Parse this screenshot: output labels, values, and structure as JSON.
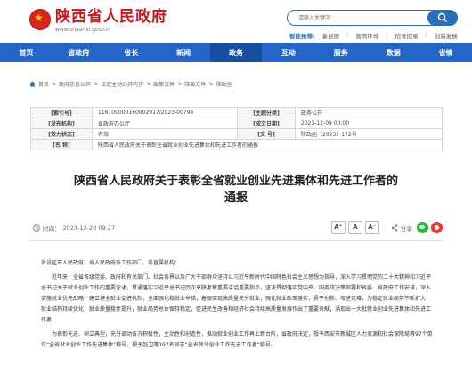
{
  "header": {
    "site_name": "陕西省人民政府",
    "site_url": "www.shaanxi.gov.cn",
    "search_placeholder": "请输入关键字",
    "smart_label": "智能推荐:",
    "smart_links": [
      "秦创原",
      "营商环境",
      "招考招录",
      "创新发展"
    ]
  },
  "nav": {
    "items": [
      "首页",
      "省政府",
      "省长",
      "新闻",
      "政务",
      "互动",
      "服务",
      "数据",
      "省情"
    ],
    "active_index": 4
  },
  "breadcrumb": [
    "首页",
    "政府信息公开",
    "法定主动公开内容",
    "政策文件",
    "陕政文件",
    "陕政函"
  ],
  "info": {
    "index_label": "[索引号]",
    "index_value": "11610000016000291​7/2023-00794",
    "category_label": "[主题分类]",
    "category_value": "政务公开",
    "issuer_label": "[发布机构]",
    "issuer_value": "省政府办公厅",
    "date_label": "[成文日期]",
    "date_value": "2023-12-09 00:00",
    "status_label": "[效力状态]",
    "status_value": "有效",
    "docno_label": "[文 号]",
    "docno_value": "陕政函〔2023〕172号",
    "name_label": "[名 称]",
    "name_value": "陕西省人民政府关于表彰全省就业创业先进集体和先进工作者的通报"
  },
  "article": {
    "title_line1": "陕西省人民政府关于表彰全省就业创业先进集体和先进工作者的",
    "title_line2": "通报",
    "time_label": "时间：",
    "time_value": "2023-12-20 09:27",
    "font_buttons": [
      "A⁺",
      "A",
      "A⁻"
    ],
    "share_label": "分享:",
    "salutation": "各设区市人民政府，省人民政府各工作部门、各直属机构：",
    "para1": "近年来，全省各级党委、政府和有关部门、社会各界以及广大干部群众坚持以习近平新时代中国特色社会主义思想为指导，深入学习贯彻党的二十大精神和习近平总书记关于就业创业工作的重要论述，贯通落实习近平总书记历次来陕考察重要讲话重要指示，坚决贯彻落实党中央、国务院决策部署和省委、省政府工作安排，深入实施就业优先战略，建立健全就业促进机制，全面强化稳就业举措，着眼实现高质量充分就业，强化就业政策落实，勇于创新、攻坚克难，为稳定就业局势不断扩大，就业结构持续优化，就业质量稳步提升，就业局势总体保持稳定，促进民生改善和经济社会持续高质量发展作出了重要贡献，涌现出一大批就业创业先进集体和先进工作者。",
    "para2": "为表彰先进、树立典型，充分调动各方积极性，主动性和创造性，推动就业创业工作再上新台阶，省政府决定，授予西安市新城区人力资源和社会保障局等97个单位“全省就业创业工作先进集体”称号，授予赵卫等197名同志“全省就业创业工作先进工作者”称号。"
  }
}
